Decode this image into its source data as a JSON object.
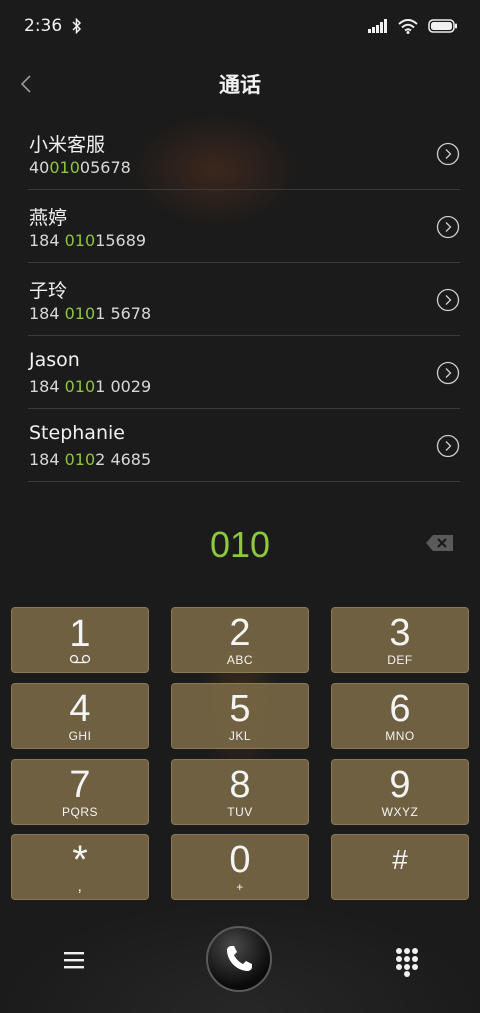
{
  "status_bar": {
    "time": "2:36",
    "icons": [
      "bluetooth-icon",
      "signal-icon",
      "wifi-icon",
      "battery-icon"
    ]
  },
  "header": {
    "title": "通话"
  },
  "contacts": [
    {
      "name": "小米客服",
      "number_pre": "40",
      "number_match": "010",
      "number_post": "05678"
    },
    {
      "name": "燕婷",
      "number_pre": "184 ",
      "number_match": "010",
      "number_post": "15689"
    },
    {
      "name": "子玲",
      "number_pre": "184 ",
      "number_match": "010",
      "number_post": "1 5678"
    },
    {
      "name": "Jason",
      "number_pre": "184 ",
      "number_match": "010",
      "number_post": "1 0029"
    },
    {
      "name": "Stephanie",
      "number_pre": "184 ",
      "number_match": "010",
      "number_post": "2 4685"
    }
  ],
  "dialer": {
    "input": "010"
  },
  "keys": [
    {
      "digit": "1",
      "letters": ""
    },
    {
      "digit": "2",
      "letters": "ABC"
    },
    {
      "digit": "3",
      "letters": "DEF"
    },
    {
      "digit": "4",
      "letters": "GHI"
    },
    {
      "digit": "5",
      "letters": "JKL"
    },
    {
      "digit": "6",
      "letters": "MNO"
    },
    {
      "digit": "7",
      "letters": "PQRS"
    },
    {
      "digit": "8",
      "letters": "TUV"
    },
    {
      "digit": "9",
      "letters": "WXYZ"
    },
    {
      "digit": "*",
      "letters": ","
    },
    {
      "digit": "0",
      "letters": "+"
    },
    {
      "digit": "#",
      "letters": ""
    }
  ],
  "colors": {
    "match_highlight": "#8dc63f",
    "key_background": "#7d6c48",
    "background": "#1b1b1b"
  }
}
